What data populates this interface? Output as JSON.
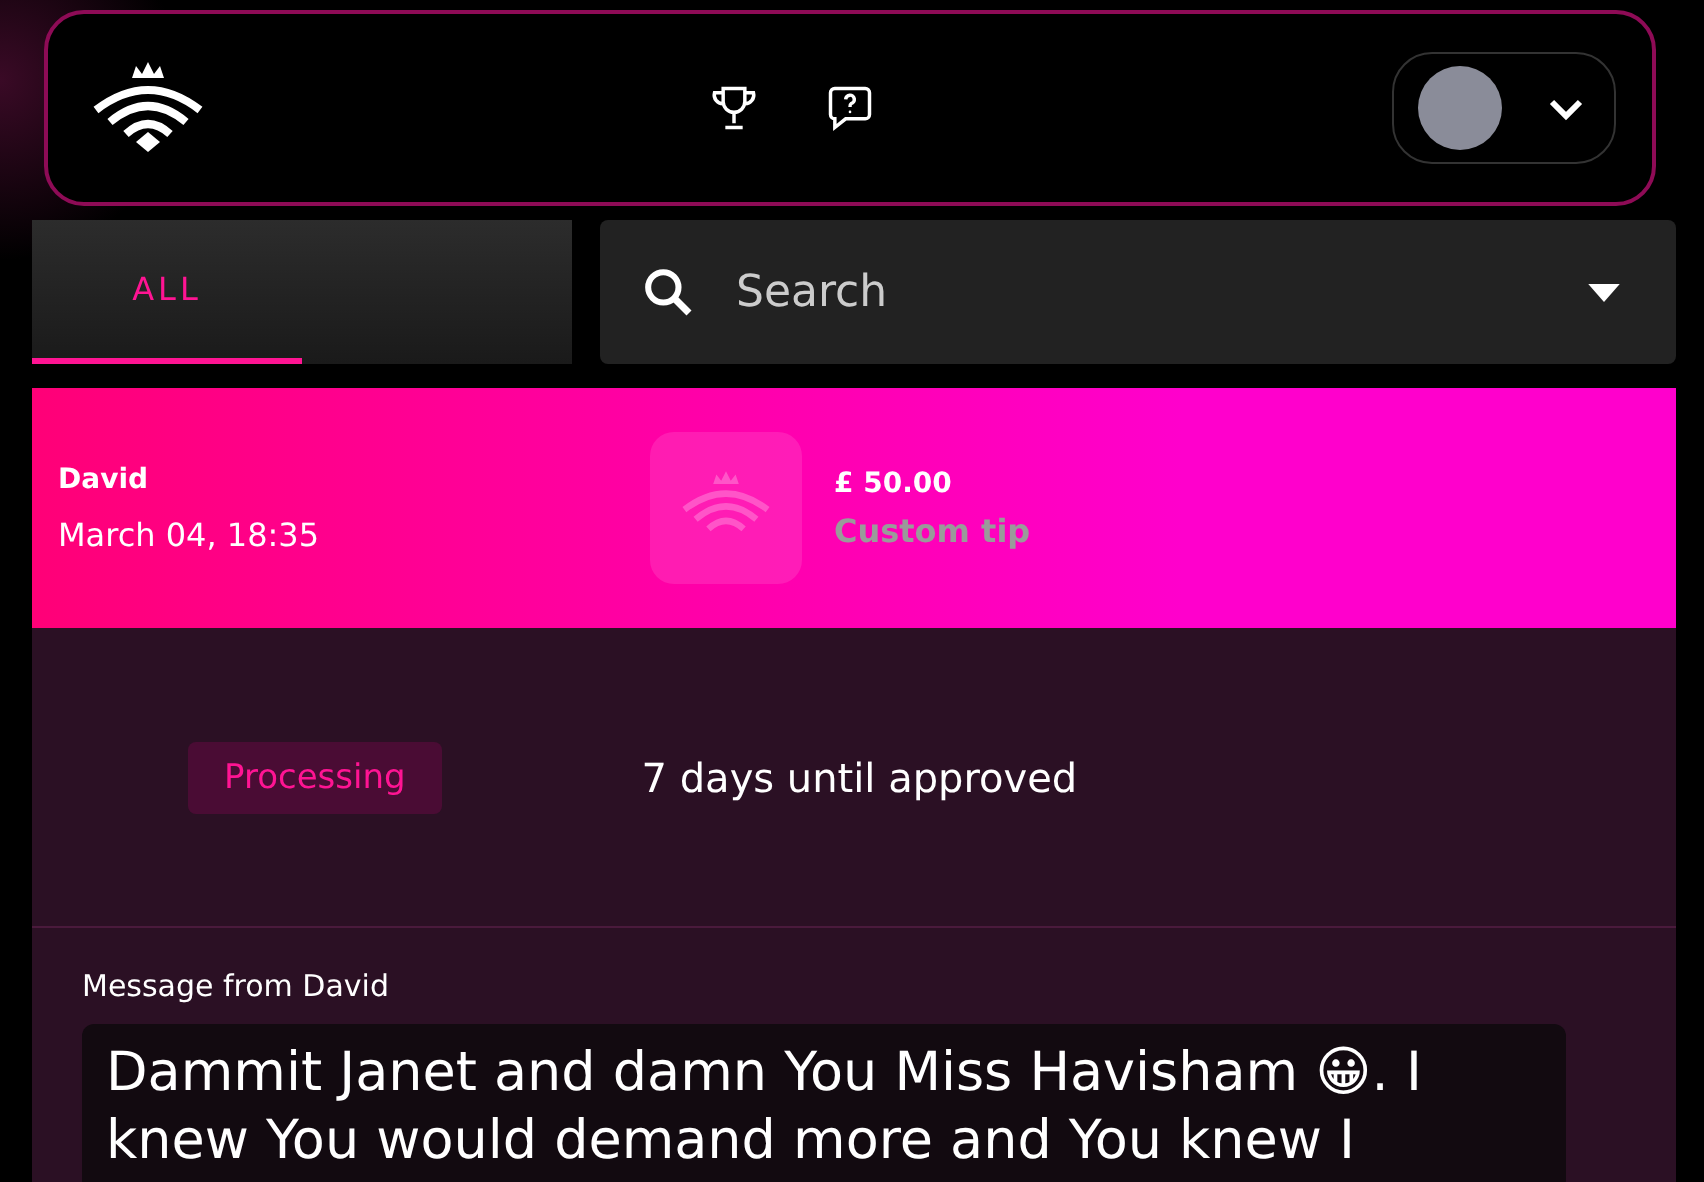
{
  "tabs": [
    {
      "label": "ALL",
      "selected": true
    }
  ],
  "search": {
    "placeholder": "Search"
  },
  "tip": {
    "sender": "David",
    "date": "March 04, 18:35",
    "amount": "£ 50.00",
    "type": "Custom tip"
  },
  "status": {
    "badge": "Processing",
    "note": "7 days until approved"
  },
  "message": {
    "label": "Message from David",
    "text": "Dammit Janet and damn You Miss Havisham 😀. I knew You would demand more and You knew I"
  }
}
